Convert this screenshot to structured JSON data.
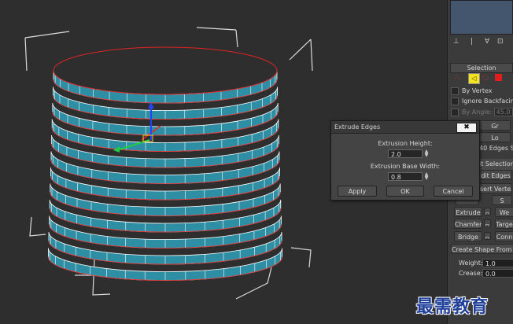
{
  "dialog": {
    "title": "Extrude Edges",
    "close_label": "✖",
    "extrusion_height_label": "Extrusion Height:",
    "extrusion_height_value": "2.0",
    "extrusion_base_width_label": "Extrusion Base Width:",
    "extrusion_base_width_value": "0.8",
    "apply_label": "Apply",
    "ok_label": "OK",
    "cancel_label": "Cancel"
  },
  "panel": {
    "selection_header": "Selection",
    "by_vertex": "By Vertex",
    "ignore_backfacing": "Ignore Backfacing",
    "by_angle": "By Angle:",
    "by_angle_value": "45.0",
    "grow_label": "Gr",
    "loop_label": "Lo",
    "edges_selected": "40 Edges S",
    "edit_selection": "it Selection",
    "edit_edges": "dit Edges",
    "insert_vertex": "sert Vertex",
    "extrude": "Extrude",
    "weld": "We",
    "chamfer": "Chamfer",
    "target_weld": "Targe",
    "bridge": "Bridge",
    "connect": "Conn",
    "create_shape": "Create Shape From Se",
    "weight_label": "Weight:",
    "weight_value": "1.0",
    "crease_label": "Crease:",
    "crease_value": "0.0"
  },
  "colors": {
    "mesh_face": "#2e8ea3",
    "mesh_edge": "#ffffff",
    "selected_edge": "#e02424",
    "gizmo_y": "#22cc44",
    "gizmo_z": "#2244ff",
    "gizmo_x": "#ee2222"
  },
  "watermark": "最需教育"
}
